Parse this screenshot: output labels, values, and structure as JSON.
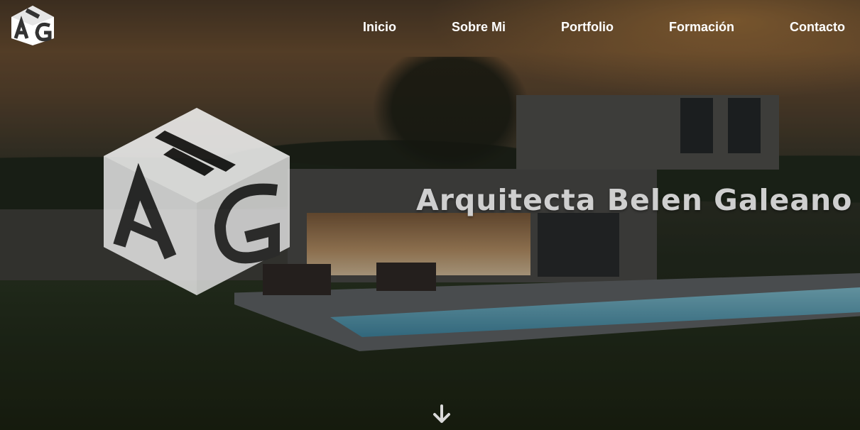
{
  "brand": {
    "logo_icon": "ab-g-cube-logo"
  },
  "nav": {
    "items": [
      {
        "label": "Inicio"
      },
      {
        "label": "Sobre Mi"
      },
      {
        "label": "Portfolio"
      },
      {
        "label": "Formación"
      },
      {
        "label": "Contacto"
      }
    ]
  },
  "hero": {
    "title": "Arquitecta Belen Galeano",
    "background_icon": "modern-house-with-pool-photo",
    "scroll_icon": "arrow-down-icon"
  },
  "colors": {
    "nav_text": "#ffffff",
    "title_text": "#cfcfcf"
  }
}
